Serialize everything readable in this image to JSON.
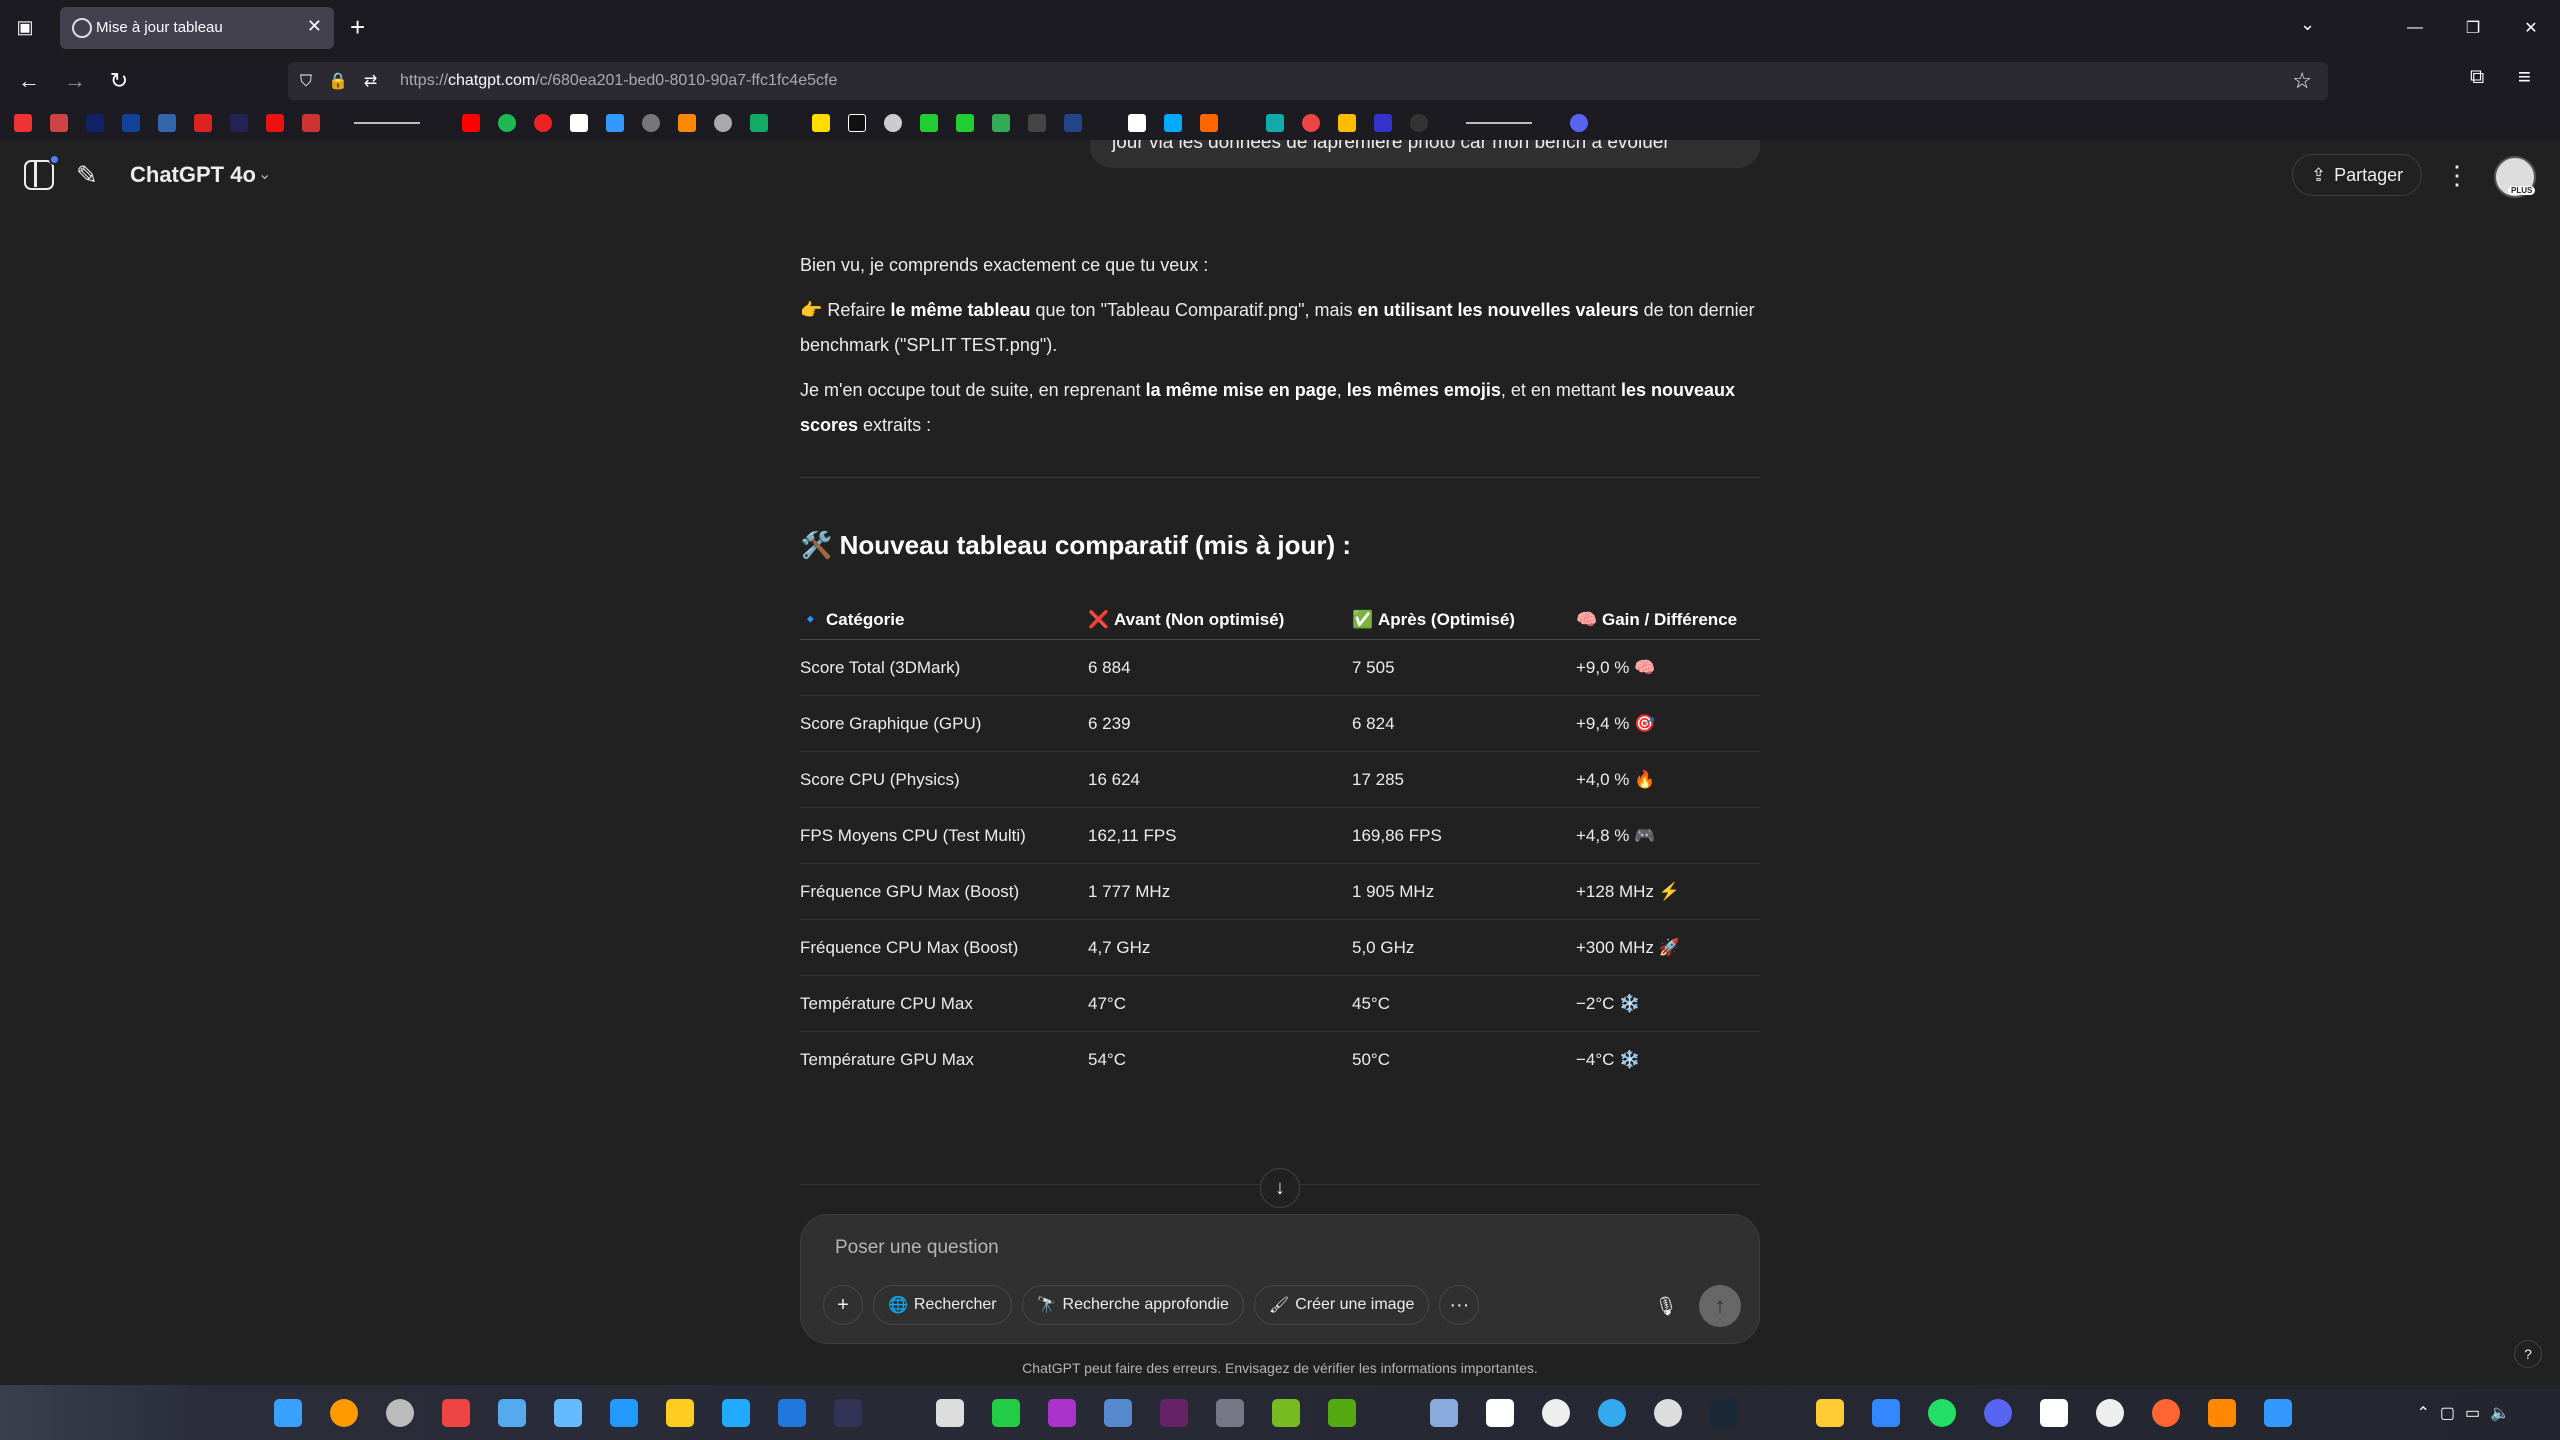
{
  "browser": {
    "tab_title": "Mise à jour tableau",
    "url_prefix": "https://",
    "url_host": "chatgpt.com",
    "url_path": "/c/680ea201-bed0-8010-90a7-ffc1fc4e5cfe"
  },
  "header": {
    "model_name": "ChatGPT 4o",
    "share_label": "Partager",
    "avatar_badge": "PLUS"
  },
  "user_message_tail": "jour via les données de lapremière photo car mon bench a évoluer",
  "assistant": {
    "p1": "Bien vu, je comprends exactement ce que tu veux :",
    "p2_emoji": "👉",
    "p2_a": " Refaire ",
    "p2_b": "le même tableau",
    "p2_c": " que ton \"Tableau Comparatif.png\", mais ",
    "p2_d": "en utilisant les nouvelles valeurs",
    "p2_e": " de ton dernier benchmark (\"SPLIT TEST.png\").",
    "p3_a": "Je m'en occupe tout de suite, en reprenant ",
    "p3_b": "la même mise en page",
    "p3_c": ", ",
    "p3_d": "les mêmes emojis",
    "p3_e": ", et en mettant ",
    "p3_f": "les nouveaux scores",
    "p3_g": " extraits :",
    "heading_emoji": "🛠️",
    "heading": "Nouveau tableau comparatif (mis à jour) :"
  },
  "table": {
    "headers": [
      {
        "icon": "🔹",
        "label": "Catégorie"
      },
      {
        "icon": "❌",
        "label": "Avant (Non optimisé)"
      },
      {
        "icon": "✅",
        "label": "Après (Optimisé)"
      },
      {
        "icon": "🧠",
        "label": "Gain / Différence"
      }
    ],
    "rows": [
      {
        "cat": "Score Total (3DMark)",
        "before": "6 884",
        "after": "7 505",
        "gain": "+9,0 %",
        "emoji": "🧠"
      },
      {
        "cat": "Score Graphique (GPU)",
        "before": "6 239",
        "after": "6 824",
        "gain": "+9,4 %",
        "emoji": "🎯"
      },
      {
        "cat": "Score CPU (Physics)",
        "before": "16 624",
        "after": "17 285",
        "gain": "+4,0 %",
        "emoji": "🔥"
      },
      {
        "cat": "FPS Moyens CPU (Test Multi)",
        "before": "162,11 FPS",
        "after": "169,86 FPS",
        "gain": "+4,8 %",
        "emoji": "🎮"
      },
      {
        "cat": "Fréquence GPU Max (Boost)",
        "before": "1 777 MHz",
        "after": "1 905 MHz",
        "gain": "+128 MHz",
        "emoji": "⚡"
      },
      {
        "cat": "Fréquence CPU Max (Boost)",
        "before": "4,7 GHz",
        "after": "5,0 GHz",
        "gain": "+300 MHz",
        "emoji": "🚀"
      },
      {
        "cat": "Température CPU Max",
        "before": "47°C",
        "after": "45°C",
        "gain": "−2°C",
        "emoji": "❄️"
      },
      {
        "cat": "Température GPU Max",
        "before": "54°C",
        "after": "50°C",
        "gain": "−4°C",
        "emoji": "❄️"
      }
    ]
  },
  "composer": {
    "placeholder": "Poser une question",
    "plus": "+",
    "search_label": "Rechercher",
    "deep_search_label": "Recherche approfondie",
    "image_label": "Créer une image",
    "more": "···"
  },
  "disclaimer": "ChatGPT peut faire des erreurs. Envisagez de vérifier les informations importantes.",
  "help": "?",
  "colors": {
    "background": "#212121",
    "composer": "#303030",
    "browser_chrome": "#1c1b22",
    "accent_blue": "#4d7fff"
  },
  "icons": [
    "sidebar-toggle-icon",
    "new-chat-icon",
    "chevron-down-icon",
    "share-icon",
    "more-vertical-icon",
    "arrow-down-icon",
    "plus-icon",
    "globe-icon",
    "telescope-icon",
    "image-icon",
    "ellipsis-icon",
    "mic-icon",
    "arrow-up-icon"
  ]
}
